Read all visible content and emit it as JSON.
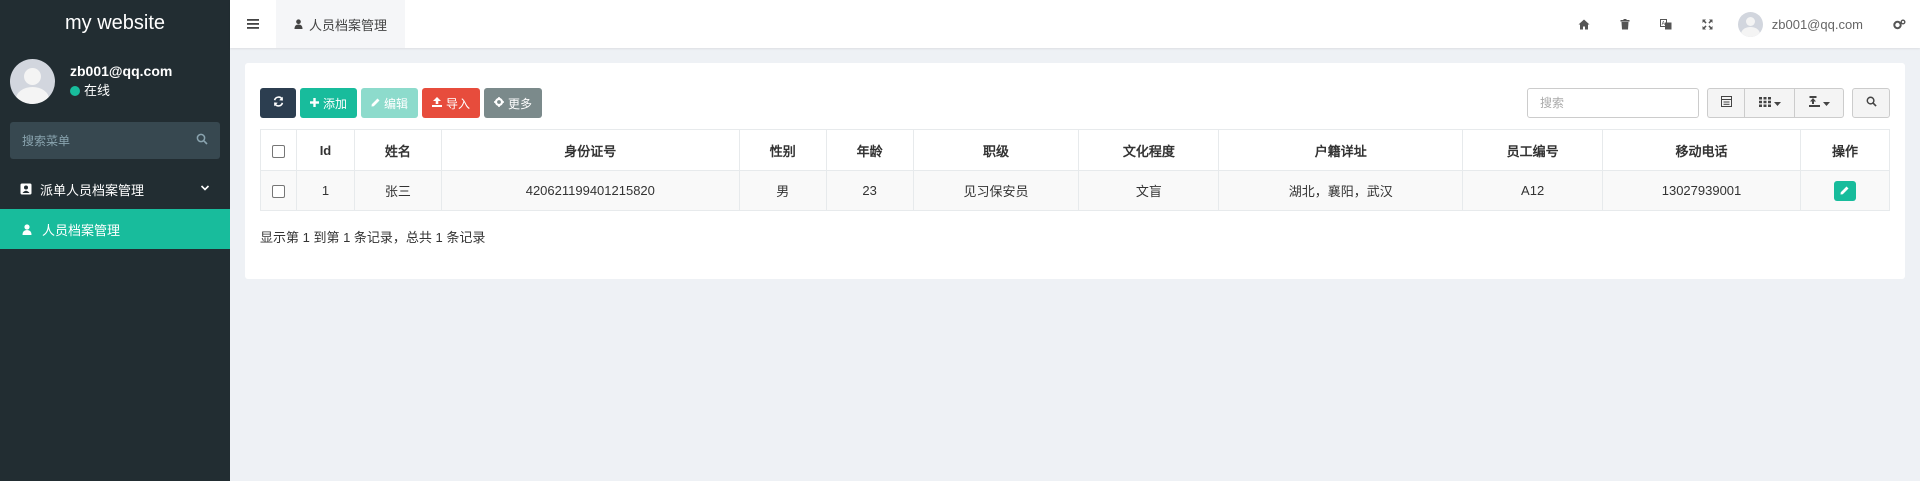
{
  "brand": "my website",
  "sidebar_user": {
    "name": "zb001@qq.com",
    "status": "在线"
  },
  "sidebar_search": {
    "placeholder": "搜索菜单"
  },
  "menu": [
    {
      "label": "派单人员档案管理",
      "icon": "contact-card-icon",
      "expandable": true
    },
    {
      "label": "人员档案管理",
      "icon": "user-icon",
      "active": true
    }
  ],
  "header": {
    "tab": "人员档案管理",
    "user": "zb001@qq.com",
    "icons": [
      "home-icon",
      "trash-icon",
      "translate-icon",
      "fullscreen-icon",
      "settings-icon"
    ]
  },
  "toolbar": {
    "add": "添加",
    "edit": "编辑",
    "import": "导入",
    "more": "更多"
  },
  "search": {
    "placeholder": "搜索"
  },
  "table": {
    "columns": [
      "Id",
      "姓名",
      "身份证号",
      "性别",
      "年龄",
      "职级",
      "文化程度",
      "户籍详址",
      "员工编号",
      "移动电话",
      "操作"
    ],
    "rows": [
      {
        "id": "1",
        "name": "张三",
        "idcard": "420621199401215820",
        "gender": "男",
        "age": "23",
        "rank": "见习保安员",
        "education": "文盲",
        "address": "湖北，襄阳，武汉",
        "emp_no": "A12",
        "phone": "13027939001"
      }
    ]
  },
  "pager": "显示第 1 到第 1 条记录，总共 1 条记录",
  "colors": {
    "sidebar": "#222d32",
    "accent": "#18bc9c",
    "danger": "#e74c3c",
    "dark": "#2c3e50",
    "gray": "#7b8a8b",
    "background": "#eef1f5"
  }
}
